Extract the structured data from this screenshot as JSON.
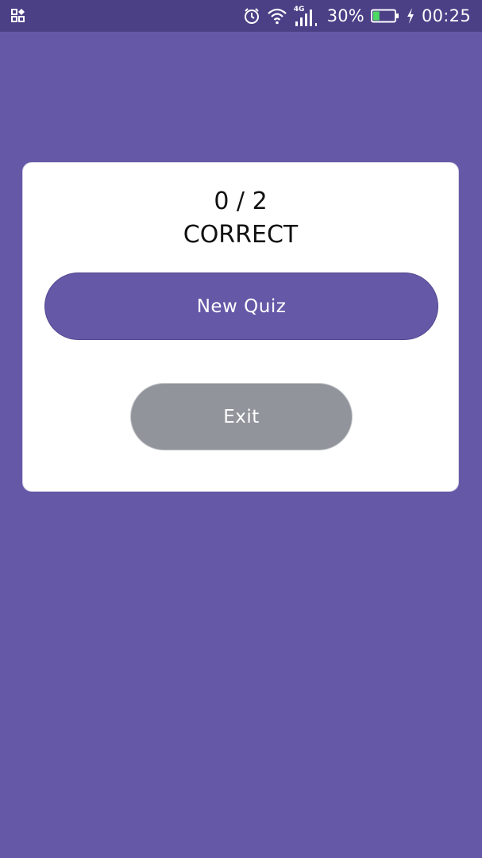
{
  "status_bar": {
    "left_icon": "qr-code-icon",
    "icons": [
      "alarm-clock-icon",
      "wifi-icon",
      "signal-4g-icon",
      "battery-icon",
      "charging-bolt-icon"
    ],
    "network_type": "4G",
    "battery_percent": "30%",
    "battery_level": 0.3,
    "time": "00:25"
  },
  "result_card": {
    "score": "0 / 2",
    "label": "CORRECT"
  },
  "actions": {
    "new_quiz_label": "New Quiz",
    "exit_label": "Exit"
  },
  "colors": {
    "background": "#6558a7",
    "status_bar": "#4b3f86",
    "primary_button": "#6558a7",
    "secondary_button": "#91959b",
    "card": "#ffffff",
    "battery_fill": "#4cd964"
  }
}
